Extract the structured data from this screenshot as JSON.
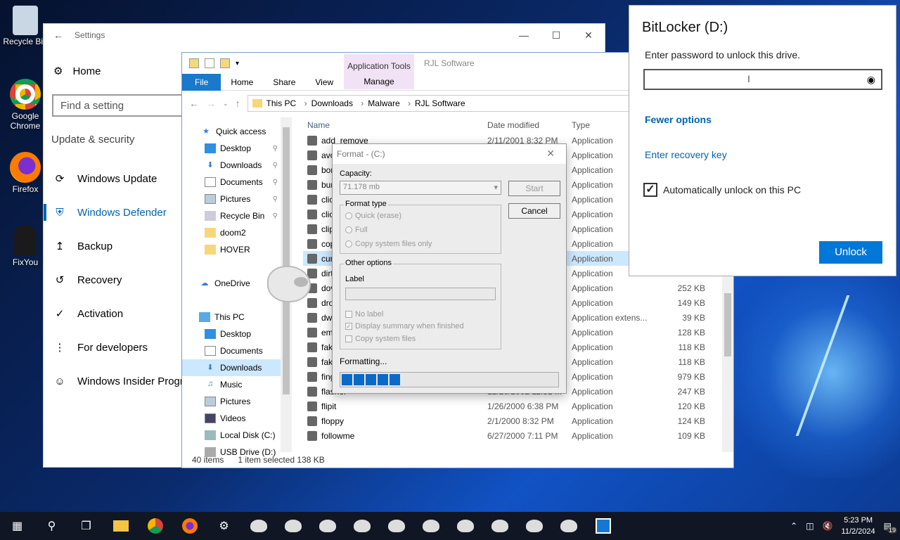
{
  "desktop": {
    "icons": [
      {
        "label": "Recycle Bin"
      },
      {
        "label": "Google Chrome"
      },
      {
        "label": "Firefox"
      },
      {
        "label": "FixYou"
      }
    ]
  },
  "settings": {
    "title": "Settings",
    "home": "Home",
    "search_placeholder": "Find a setting",
    "section": "Update & security",
    "nav": [
      {
        "label": "Windows Update",
        "icon": "refresh-icon"
      },
      {
        "label": "Windows Defender",
        "icon": "shield-icon"
      },
      {
        "label": "Backup",
        "icon": "upload-icon"
      },
      {
        "label": "Recovery",
        "icon": "history-icon"
      },
      {
        "label": "Activation",
        "icon": "check-circle-icon"
      },
      {
        "label": "For developers",
        "icon": "developer-icon"
      },
      {
        "label": "Windows Insider Progr",
        "icon": "insider-icon"
      }
    ]
  },
  "explorer": {
    "ribbon_context": "Application Tools",
    "ribbon_context_tab": "Manage",
    "title": "RJL Software",
    "tabs": [
      "File",
      "Home",
      "Share",
      "View"
    ],
    "breadcrumb": [
      "This PC",
      "Downloads",
      "Malware",
      "RJL Software"
    ],
    "sidebar": [
      {
        "label": "Quick access",
        "indent": 0,
        "pinned": false
      },
      {
        "label": "Desktop",
        "indent": 1,
        "pinned": true
      },
      {
        "label": "Downloads",
        "indent": 1,
        "pinned": true
      },
      {
        "label": "Documents",
        "indent": 1,
        "pinned": true
      },
      {
        "label": "Pictures",
        "indent": 1,
        "pinned": true
      },
      {
        "label": "Recycle Bin",
        "indent": 1,
        "pinned": true
      },
      {
        "label": "doom2",
        "indent": 1,
        "pinned": false
      },
      {
        "label": "HOVER",
        "indent": 1,
        "pinned": false
      },
      {
        "label": "",
        "indent": 0,
        "pinned": false
      },
      {
        "label": "OneDrive",
        "indent": 0,
        "pinned": false
      },
      {
        "label": "",
        "indent": 0,
        "pinned": false
      },
      {
        "label": "This PC",
        "indent": 0,
        "pinned": false
      },
      {
        "label": "Desktop",
        "indent": 1,
        "pinned": false
      },
      {
        "label": "Documents",
        "indent": 1,
        "pinned": false
      },
      {
        "label": "Downloads",
        "indent": 1,
        "pinned": false,
        "selected": true
      },
      {
        "label": "Music",
        "indent": 1,
        "pinned": false
      },
      {
        "label": "Pictures",
        "indent": 1,
        "pinned": false
      },
      {
        "label": "Videos",
        "indent": 1,
        "pinned": false
      },
      {
        "label": "Local Disk (C:)",
        "indent": 1,
        "pinned": false
      },
      {
        "label": "USB Drive (D:)",
        "indent": 1,
        "pinned": false
      }
    ],
    "columns": [
      "Name",
      "Date modified",
      "Type",
      ""
    ],
    "rows": [
      {
        "name": "add_remove",
        "date": "2/11/2001 8:32 PM",
        "type": "Application",
        "size": ""
      },
      {
        "name": "avo",
        "date": "",
        "type": "Application",
        "size": ""
      },
      {
        "name": "bor",
        "date": "",
        "type": "Application",
        "size": ""
      },
      {
        "name": "bur",
        "date": "",
        "type": "Application",
        "size": ""
      },
      {
        "name": "clic",
        "date": "",
        "type": "Application",
        "size": ""
      },
      {
        "name": "clic",
        "date": "",
        "type": "Application",
        "size": ""
      },
      {
        "name": "clip",
        "date": "",
        "type": "Application",
        "size": ""
      },
      {
        "name": "cop",
        "date": "",
        "type": "Application",
        "size": ""
      },
      {
        "name": "cur",
        "date": "",
        "type": "Application",
        "size": "",
        "selected": true
      },
      {
        "name": "dirt",
        "date": "",
        "type": "Application",
        "size": "112 KB"
      },
      {
        "name": "dov",
        "date": "",
        "type": "Application",
        "size": "252 KB"
      },
      {
        "name": "dro",
        "date": "",
        "type": "Application",
        "size": "149 KB"
      },
      {
        "name": "dw",
        "date": "",
        "type": "Application extens...",
        "size": "39 KB"
      },
      {
        "name": "em",
        "date": "",
        "type": "Application",
        "size": "128 KB"
      },
      {
        "name": "fak",
        "date": "",
        "type": "Application",
        "size": "118 KB"
      },
      {
        "name": "fak",
        "date": "",
        "type": "Application",
        "size": "118 KB"
      },
      {
        "name": "fing",
        "date": "",
        "type": "Application",
        "size": "979 KB"
      },
      {
        "name": "flasher",
        "date": "12/26/2002 11:31 ...",
        "type": "Application",
        "size": "247 KB"
      },
      {
        "name": "flipit",
        "date": "1/26/2000 6:38 PM",
        "type": "Application",
        "size": "120 KB"
      },
      {
        "name": "floppy",
        "date": "2/1/2000 8:32 PM",
        "type": "Application",
        "size": "124 KB"
      },
      {
        "name": "followme",
        "date": "6/27/2000 7:11 PM",
        "type": "Application",
        "size": "109 KB"
      }
    ],
    "status": [
      "40 items",
      "1 item selected  138 KB"
    ]
  },
  "format_dialog": {
    "title": "Format -  (C:)",
    "capacity_label": "Capacity:",
    "capacity_value": "71.178 mb",
    "start": "Start",
    "cancel": "Cancel",
    "format_type_label": "Format type",
    "quick": "Quick (erase)",
    "full": "Full",
    "copy_only": "Copy system files only",
    "other_label": "Other options",
    "label_label": "Label",
    "no_label": "No label",
    "display_summary": "Display summary when finished",
    "copy_system": "Copy system files",
    "status": "Formatting...",
    "progress_blocks": 5
  },
  "bitlocker": {
    "title": "BitLocker (D:)",
    "prompt": "Enter password to unlock this drive.",
    "fewer_options": "Fewer options",
    "recovery_key": "Enter recovery key",
    "auto_unlock": "Automatically unlock on this PC",
    "unlock": "Unlock"
  },
  "taskbar": {
    "time": "5:23 PM",
    "date": "11/2/2024",
    "notifications": "19"
  }
}
